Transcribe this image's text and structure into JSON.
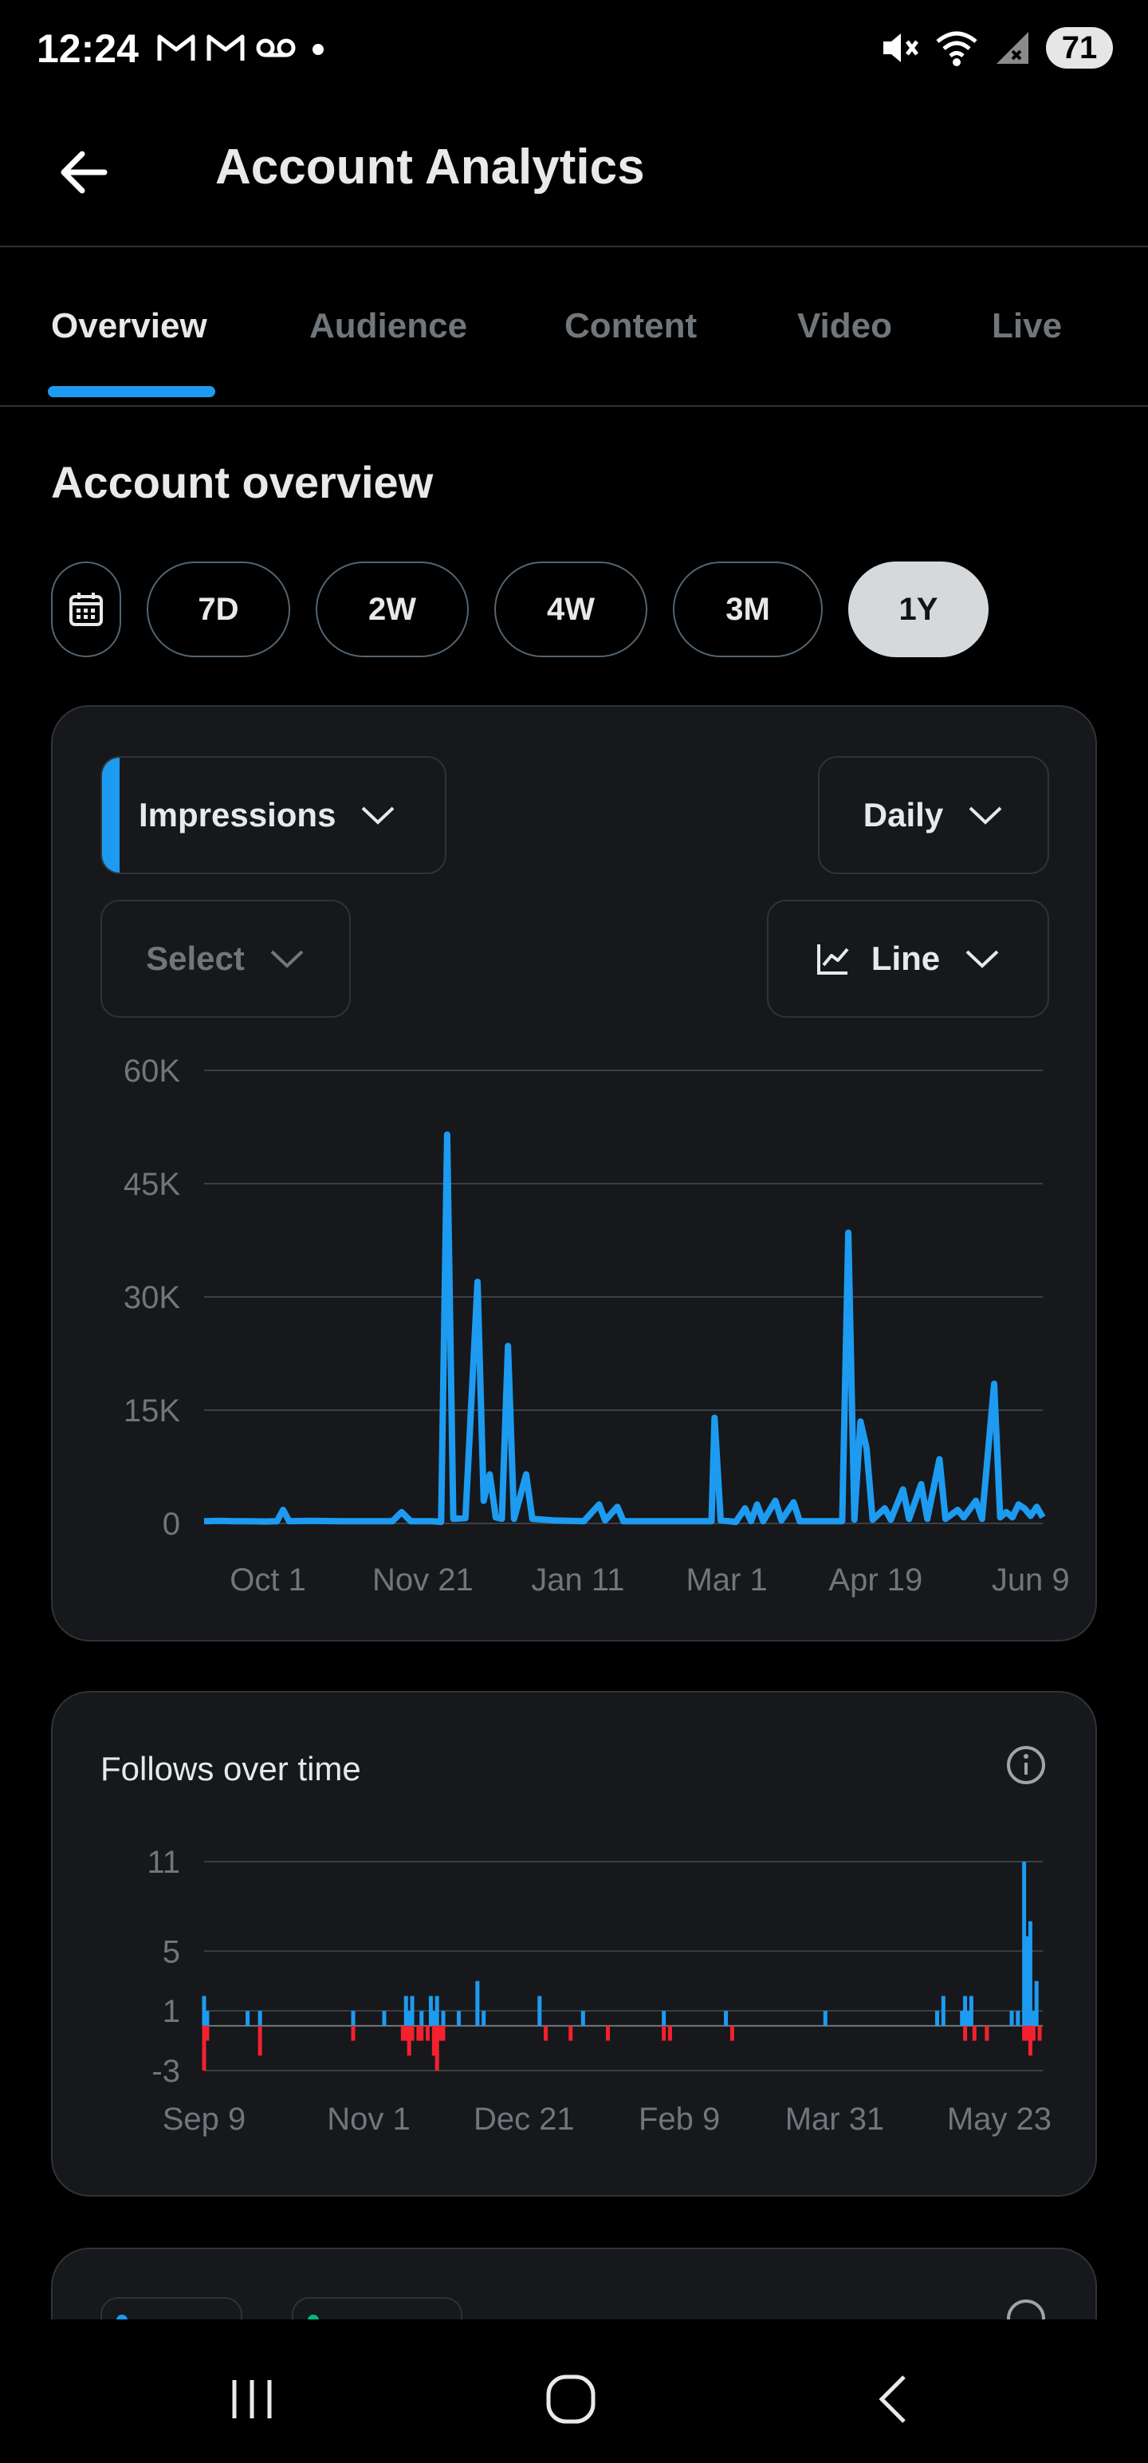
{
  "status_bar": {
    "time": "12:24",
    "battery": "71"
  },
  "header": {
    "title": "Account Analytics"
  },
  "tabs": [
    "Overview",
    "Audience",
    "Content",
    "Video",
    "Live"
  ],
  "overview": {
    "title": "Account overview",
    "ranges": [
      "7D",
      "2W",
      "4W",
      "3M",
      "1Y"
    ],
    "selected_range": "1Y"
  },
  "impressions_card": {
    "metric_label": "Impressions",
    "interval_label": "Daily",
    "compare_placeholder": "Select",
    "chart_type_label": "Line"
  },
  "follows_card": {
    "title": "Follows over time"
  },
  "colors": {
    "accent": "#1d9bf0",
    "negative": "#f4212e",
    "card": "#16181c",
    "green": "#00ba7c"
  },
  "chart_data": [
    {
      "type": "line",
      "title": "",
      "xlabel": "",
      "ylabel": "",
      "ylim": [
        0,
        60000
      ],
      "y_ticks": [
        "0",
        "15K",
        "30K",
        "45K",
        "60K"
      ],
      "x_ticks": [
        "Oct 1",
        "Nov 21",
        "Jan 11",
        "Mar 1",
        "Apr 19",
        "Jun 9"
      ],
      "x_tick_days": [
        21,
        72,
        123,
        172,
        221,
        272
      ],
      "series": [
        {
          "color": "#1d9bf0",
          "points": [
            [
              0,
              300
            ],
            [
              5,
              350
            ],
            [
              10,
              280
            ],
            [
              15,
              300
            ],
            [
              20,
              250
            ],
            [
              24,
              300
            ],
            [
              26,
              1800
            ],
            [
              28,
              300
            ],
            [
              35,
              350
            ],
            [
              45,
              300
            ],
            [
              55,
              280
            ],
            [
              62,
              300
            ],
            [
              65,
              1500
            ],
            [
              68,
              300
            ],
            [
              75,
              280
            ],
            [
              78,
              200
            ],
            [
              80,
              51500
            ],
            [
              82,
              600
            ],
            [
              86,
              700
            ],
            [
              90,
              32000
            ],
            [
              92,
              3000
            ],
            [
              94,
              6500
            ],
            [
              96,
              800
            ],
            [
              98,
              600
            ],
            [
              100,
              23500
            ],
            [
              102,
              600
            ],
            [
              106,
              6500
            ],
            [
              108,
              600
            ],
            [
              115,
              400
            ],
            [
              125,
              300
            ],
            [
              130,
              2500
            ],
            [
              132,
              400
            ],
            [
              136,
              2200
            ],
            [
              138,
              300
            ],
            [
              150,
              280
            ],
            [
              160,
              300
            ],
            [
              167,
              300
            ],
            [
              168,
              14000
            ],
            [
              170,
              400
            ],
            [
              175,
              200
            ],
            [
              178,
              2000
            ],
            [
              180,
              300
            ],
            [
              182,
              2500
            ],
            [
              184,
              300
            ],
            [
              188,
              3000
            ],
            [
              190,
              400
            ],
            [
              194,
              2800
            ],
            [
              196,
              300
            ],
            [
              205,
              300
            ],
            [
              210,
              300
            ],
            [
              212,
              38500
            ],
            [
              214,
              500
            ],
            [
              216,
              13500
            ],
            [
              218,
              10000
            ],
            [
              220,
              500
            ],
            [
              224,
              2000
            ],
            [
              226,
              500
            ],
            [
              230,
              4500
            ],
            [
              232,
              600
            ],
            [
              236,
              5200
            ],
            [
              238,
              600
            ],
            [
              242,
              8500
            ],
            [
              244,
              600
            ],
            [
              248,
              1800
            ],
            [
              250,
              800
            ],
            [
              254,
              3000
            ],
            [
              256,
              600
            ],
            [
              260,
              18500
            ],
            [
              262,
              800
            ],
            [
              264,
              1500
            ],
            [
              266,
              800
            ],
            [
              268,
              2500
            ],
            [
              270,
              2000
            ],
            [
              272,
              1000
            ],
            [
              274,
              2200
            ],
            [
              276,
              800
            ]
          ]
        }
      ]
    },
    {
      "type": "bar",
      "title": "Follows over time",
      "xlabel": "",
      "ylabel": "",
      "ylim": [
        -3,
        11
      ],
      "y_ticks": [
        "-3",
        "1",
        "5",
        "11"
      ],
      "y_tick_values": [
        -3,
        1,
        5,
        11
      ],
      "x_ticks": [
        "Sep 9",
        "Nov 1",
        "Dec 21",
        "Feb 9",
        "Mar 31",
        "May 23"
      ],
      "x_tick_days": [
        0,
        53,
        103,
        153,
        203,
        256
      ],
      "series": [
        {
          "name": "follows",
          "color": "#1d9bf0",
          "points": [
            [
              0,
              2
            ],
            [
              1,
              1
            ],
            [
              14,
              1
            ],
            [
              18,
              1
            ],
            [
              48,
              1
            ],
            [
              58,
              1
            ],
            [
              65,
              2
            ],
            [
              66,
              1
            ],
            [
              67,
              2
            ],
            [
              70,
              1
            ],
            [
              73,
              2
            ],
            [
              74,
              1
            ],
            [
              75,
              2
            ],
            [
              77,
              1
            ],
            [
              82,
              1
            ],
            [
              88,
              3
            ],
            [
              90,
              1
            ],
            [
              108,
              2
            ],
            [
              122,
              1
            ],
            [
              148,
              1
            ],
            [
              168,
              1
            ],
            [
              200,
              1
            ],
            [
              236,
              1
            ],
            [
              238,
              2
            ],
            [
              244,
              1
            ],
            [
              245,
              2
            ],
            [
              246,
              1
            ],
            [
              247,
              2
            ],
            [
              260,
              1
            ],
            [
              262,
              1
            ],
            [
              264,
              11
            ],
            [
              265,
              6
            ],
            [
              266,
              7
            ],
            [
              267,
              1
            ],
            [
              268,
              3
            ]
          ]
        },
        {
          "name": "unfollows",
          "color": "#f4212e",
          "points": [
            [
              0,
              -3
            ],
            [
              1,
              -1
            ],
            [
              18,
              -2
            ],
            [
              48,
              -1
            ],
            [
              64,
              -1
            ],
            [
              65,
              -1
            ],
            [
              66,
              -2
            ],
            [
              67,
              -1
            ],
            [
              69,
              -1
            ],
            [
              70,
              -1
            ],
            [
              72,
              -1
            ],
            [
              74,
              -2
            ],
            [
              75,
              -3
            ],
            [
              76,
              -1
            ],
            [
              77,
              -1
            ],
            [
              110,
              -1
            ],
            [
              118,
              -1
            ],
            [
              130,
              -1
            ],
            [
              148,
              -1
            ],
            [
              150,
              -1
            ],
            [
              170,
              -1
            ],
            [
              245,
              -1
            ],
            [
              248,
              -1
            ],
            [
              252,
              -1
            ],
            [
              264,
              -1
            ],
            [
              265,
              -1
            ],
            [
              266,
              -2
            ],
            [
              267,
              -1
            ],
            [
              269,
              -1
            ]
          ]
        }
      ]
    }
  ]
}
